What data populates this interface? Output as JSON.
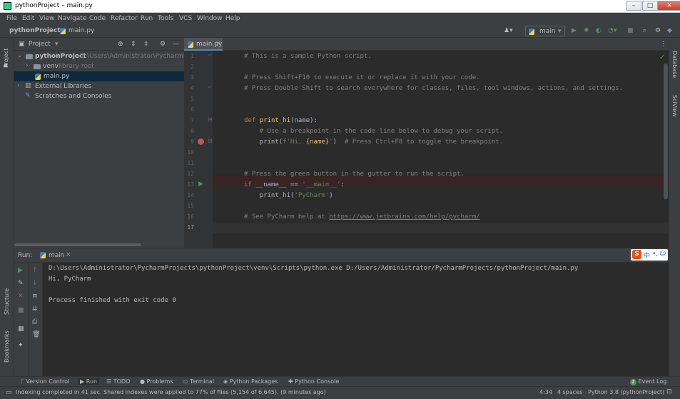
{
  "window": {
    "title": "pythonProject – main.py",
    "min": "–",
    "max": "□",
    "close": "✕"
  },
  "menu": [
    "File",
    "Edit",
    "View",
    "Navigate",
    "Code",
    "Refactor",
    "Run",
    "Tools",
    "VCS",
    "Window",
    "Help"
  ],
  "nav": {
    "project": "pythonProject",
    "file": "main.py",
    "run_config": "main"
  },
  "project_panel": {
    "title": "Project",
    "tree": [
      {
        "label": "pythonProject",
        "hint": "D:\\Users\\Administrator\\PycharmProjects\\pythonProject"
      },
      {
        "label": "venv",
        "hint": "library root"
      },
      {
        "label": "main.py",
        "hint": ""
      },
      {
        "label": "External Libraries",
        "hint": ""
      },
      {
        "label": "Scratches and Consoles",
        "hint": ""
      }
    ]
  },
  "editor": {
    "tab": "main.py",
    "lines": [
      "1",
      "2",
      "3",
      "4",
      "5",
      "6",
      "7",
      "8",
      "9",
      "10",
      "11",
      "12",
      "13",
      "14",
      "15",
      "16",
      "17"
    ],
    "code": {
      "l1": "# This is a sample Python script.",
      "l3": "# Press Shift+F10 to execute it or replace it with your code.",
      "l4": "# Press Double Shift to search everywhere for classes, files, tool windows, actions, and settings.",
      "l7_kw": "def ",
      "l7_fn": "print_hi",
      "l7_rest": "(name):",
      "l8": "    # Use a breakpoint in the code line below to debug your script.",
      "l9_a": "    print(",
      "l9_b": "f'Hi, ",
      "l9_c": "{name}",
      "l9_d": "'",
      "l9_e": ")  ",
      "l9_f": "# Press Ctrl+F8 to toggle the breakpoint.",
      "l12": "# Press the green button in the gutter to run the script.",
      "l13_kw": "if ",
      "l13_a": "__name__ == ",
      "l13_str": "'__main__'",
      "l13_b": ":",
      "l14_a": "    print_hi(",
      "l14_str": "'PyCharm'",
      "l14_b": ")",
      "l16_cmt": "# See PyCharm help at ",
      "l16_link": "https://www.jetbrains.com/help/pycharm/"
    }
  },
  "side_tools": {
    "project": "Project",
    "structure": "Structure",
    "bookmarks": "Bookmarks",
    "database": "Database",
    "sciview": "SciView"
  },
  "run_panel": {
    "label": "Run:",
    "tab": "main",
    "output": [
      "D:\\Users\\Administrator\\PycharmProjects\\pythonProject\\venv\\Scripts\\python.exe D:/Users/Administrator/PycharmProjects/pythonProject/main.py",
      "Hi, PyCharm",
      "",
      "Process finished with exit code 0"
    ]
  },
  "ime": {
    "s": "S",
    "zh": "中"
  },
  "bottom_tabs": [
    "Version Control",
    "Run",
    "TODO",
    "Problems",
    "Terminal",
    "Python Packages",
    "Python Console"
  ],
  "event_log": {
    "count": "2",
    "label": "Event Log"
  },
  "status": {
    "message": "Indexing completed in 41 sec. Shared indexes were applied to 77% of files (5,154 of 6,645). (9 minutes ago)",
    "position": "4:34",
    "indent": "4 spaces",
    "interpreter": "Python 3.8 (pythonProject)"
  },
  "colors": {
    "accent": "#4a88c7",
    "run_green": "#499c54",
    "breakpoint": "#c75450",
    "selection": "#0d293e"
  }
}
